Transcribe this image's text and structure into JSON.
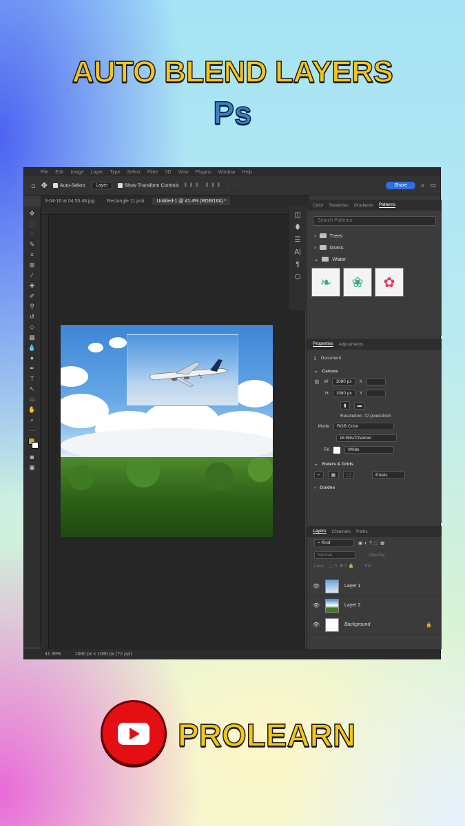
{
  "header": {
    "title": "AUTO BLEND LAYERS",
    "logo": "Ps"
  },
  "ps": {
    "menu": [
      "File",
      "Edit",
      "Image",
      "Layer",
      "Type",
      "Select",
      "Filter",
      "3D",
      "View",
      "Plugins",
      "Window",
      "Help"
    ],
    "options": {
      "auto_select": "Auto-Select:",
      "layer": "Layer",
      "transform": "Show Transform Controls",
      "share": "Share"
    },
    "tabs": [
      "3-04-16 at 04.55.48.jpg",
      "Rectangle 11.psb",
      "Untitled-1 @ 41.4% (RGB/16#) *"
    ],
    "status": {
      "zoom": "41.39%",
      "size": "1080 px x 1080 px (72 ppi)"
    },
    "patterns": {
      "tabs": [
        "Color",
        "Swatches",
        "Gradients",
        "Patterns"
      ],
      "search_placeholder": "Search Patterns",
      "folders": [
        "Trees",
        "Grass",
        "Water"
      ]
    },
    "properties": {
      "tabs": [
        "Properties",
        "Adjustments"
      ],
      "doc": "Document",
      "canvas": "Canvas",
      "w": "1080 px",
      "h": "1080 px",
      "x_label": "X",
      "y_label": "Y",
      "resolution": "Resolution: 72 pixels/inch",
      "mode_label": "Mode",
      "mode": "RGB Color",
      "bits": "16 Bits/Channel",
      "fill_label": "Fill",
      "fill": "White",
      "rulers": "Rulers & Grids",
      "units": "Pixels",
      "guides": "Guides"
    },
    "layers": {
      "tabs": [
        "Layers",
        "Channels",
        "Paths"
      ],
      "kind": "Kind",
      "normal": "Normal",
      "opacity": "Opacity:",
      "lock": "Lock:",
      "fill": "Fill:",
      "items": [
        "Layer 1",
        "Layer 2",
        "Background"
      ]
    }
  },
  "footer": {
    "brand": "PROLEARN"
  }
}
